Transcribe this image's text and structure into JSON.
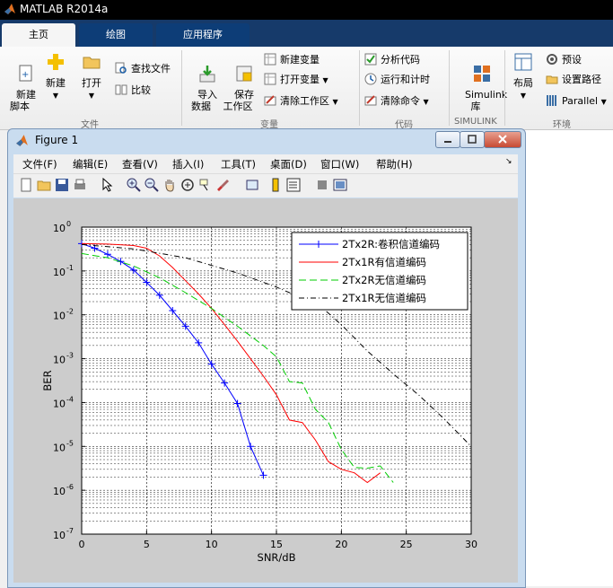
{
  "app": {
    "title": "MATLAB R2014a"
  },
  "tabs": [
    {
      "label": "主页",
      "active": true
    },
    {
      "label": "绘图",
      "active": false
    },
    {
      "label": "应用程序",
      "active": false
    }
  ],
  "ribbon": {
    "new_script": "新建\n脚本",
    "new": "新建",
    "open": "打开",
    "find_files": "查找文件",
    "compare": "比较",
    "import": "导入\n数据",
    "save_ws": "保存\n工作区",
    "new_var": "新建变量",
    "open_var": "打开变量",
    "clear_ws": "清除工作区",
    "analyze": "分析代码",
    "run_time": "运行和计时",
    "clear_cmd": "清除命令",
    "simulink": "Simulink\n库",
    "layout": "布局",
    "prefs": "预设",
    "set_path": "设置路径",
    "parallel": "Parallel",
    "sections": {
      "file": "文件",
      "variable": "变量",
      "code": "代码",
      "simulink": "SIMULINK",
      "env": "环境"
    }
  },
  "figure": {
    "title": "Figure 1",
    "menus": [
      "文件(F)",
      "编辑(E)",
      "查看(V)",
      "插入(I)",
      "工具(T)",
      "桌面(D)",
      "窗口(W)",
      "帮助(H)"
    ]
  },
  "chart_data": {
    "type": "line",
    "xlabel": "SNR/dB",
    "ylabel": "BER",
    "xlim": [
      0,
      30
    ],
    "ylim": [
      1e-07,
      1
    ],
    "yscale": "log",
    "grid": true,
    "legend_position": "top-right",
    "xticks": [
      0,
      5,
      10,
      15,
      20,
      25,
      30
    ],
    "yticks": [
      {
        "value": 1,
        "label": "10",
        "exp": "0"
      },
      {
        "value": 0.1,
        "label": "10",
        "exp": "-1"
      },
      {
        "value": 0.01,
        "label": "10",
        "exp": "-2"
      },
      {
        "value": 0.001,
        "label": "10",
        "exp": "-3"
      },
      {
        "value": 0.0001,
        "label": "10",
        "exp": "-4"
      },
      {
        "value": 1e-05,
        "label": "10",
        "exp": "-5"
      },
      {
        "value": 1e-06,
        "label": "10",
        "exp": "-6"
      },
      {
        "value": 1e-07,
        "label": "10",
        "exp": "-7"
      }
    ],
    "series": [
      {
        "name": "2Tx2R:卷积信道编码",
        "color": "#0000ff",
        "dash": "",
        "marker": "+",
        "x": [
          0,
          1,
          2,
          3,
          4,
          5,
          6,
          7,
          8,
          9,
          10,
          11,
          12,
          13,
          14
        ],
        "y": [
          0.42,
          0.33,
          0.24,
          0.165,
          0.105,
          0.055,
          0.028,
          0.0125,
          0.0055,
          0.0023,
          0.00075,
          0.00028,
          9.5e-05,
          1e-05,
          2.2e-06
        ]
      },
      {
        "name": "2Tx1R有信道编码",
        "color": "#ff0000",
        "dash": "",
        "marker": "",
        "x": [
          0,
          2,
          4,
          5,
          6,
          7,
          8,
          9,
          10,
          11,
          12,
          13,
          14,
          15,
          16,
          17,
          18,
          19,
          20,
          21,
          22,
          23
        ],
        "y": [
          0.42,
          0.41,
          0.38,
          0.33,
          0.22,
          0.12,
          0.06,
          0.03,
          0.014,
          0.006,
          0.0025,
          0.001,
          0.0004,
          0.00015,
          4e-05,
          3.5e-05,
          1.4e-05,
          4.5e-06,
          3e-06,
          2.5e-06,
          1.5e-06,
          2.5e-06
        ]
      },
      {
        "name": "2Tx2R无信道编码",
        "color": "#00cc00",
        "dash": "8,4",
        "marker": "",
        "x": [
          0,
          2,
          4,
          6,
          8,
          10,
          12,
          14,
          15,
          16,
          17,
          18,
          19,
          20,
          21,
          22,
          23,
          24
        ],
        "y": [
          0.25,
          0.2,
          0.13,
          0.07,
          0.032,
          0.014,
          0.0055,
          0.002,
          0.0011,
          0.0003,
          0.00028,
          7e-05,
          3.5e-05,
          8.5e-06,
          3.3e-06,
          3.2e-06,
          3.6e-06,
          1.5e-06
        ]
      },
      {
        "name": "2Tx1R无信道编码",
        "color": "#000000",
        "dash": "6,3,1,3",
        "marker": "",
        "x": [
          0,
          4,
          8,
          12,
          14,
          15,
          16,
          18,
          20,
          22,
          24,
          26,
          28,
          30
        ],
        "y": [
          0.4,
          0.32,
          0.2,
          0.09,
          0.055,
          0.043,
          0.032,
          0.02,
          0.006,
          0.0015,
          0.00045,
          0.000145,
          4e-05,
          1e-05
        ]
      }
    ]
  }
}
